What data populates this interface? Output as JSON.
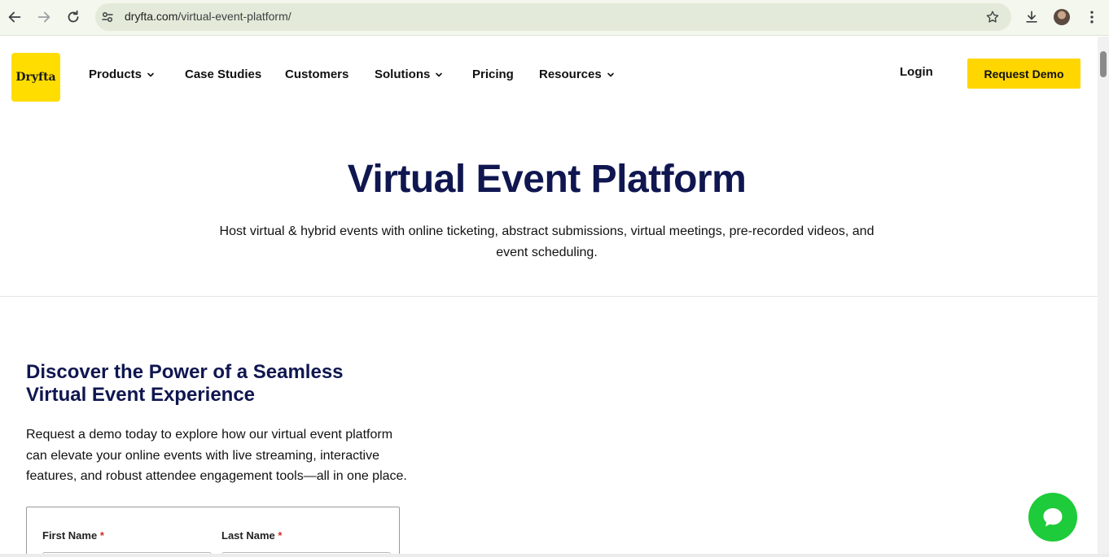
{
  "browser": {
    "url_domain": "dryfta.com",
    "url_path": "/virtual-event-platform/",
    "icons": [
      "back-icon",
      "forward-icon",
      "reload-icon",
      "site-settings-icon",
      "bookmark-star-icon",
      "download-icon",
      "profile-avatar",
      "kebab-menu-icon"
    ]
  },
  "header": {
    "logo": "Dryfta",
    "nav": [
      {
        "label": "Products",
        "dropdown": true
      },
      {
        "label": "Case Studies",
        "dropdown": false
      },
      {
        "label": "Customers",
        "dropdown": false
      },
      {
        "label": "Solutions",
        "dropdown": true
      },
      {
        "label": "Pricing",
        "dropdown": false
      },
      {
        "label": "Resources",
        "dropdown": true
      }
    ],
    "login": "Login",
    "request_demo": "Request Demo"
  },
  "hero": {
    "title": "Virtual Event Platform",
    "subtitle": "Host virtual & hybrid events with online ticketing, abstract submissions, virtual meetings, pre-recorded videos, and event scheduling."
  },
  "section": {
    "title_line1": "Discover the Power of a Seamless",
    "title_line2": "Virtual Event Experience",
    "body": "Request a demo today to explore how our virtual event platform can elevate your online events with live streaming, interactive features, and robust attendee engagement tools—all in one place."
  },
  "form": {
    "first_name_label": "First Name",
    "last_name_label": "Last Name",
    "required_mark": "*"
  },
  "colors": {
    "brand_yellow": "#ffdd00",
    "heading_navy": "#0f1650",
    "chat_green": "#1ecb3a"
  }
}
